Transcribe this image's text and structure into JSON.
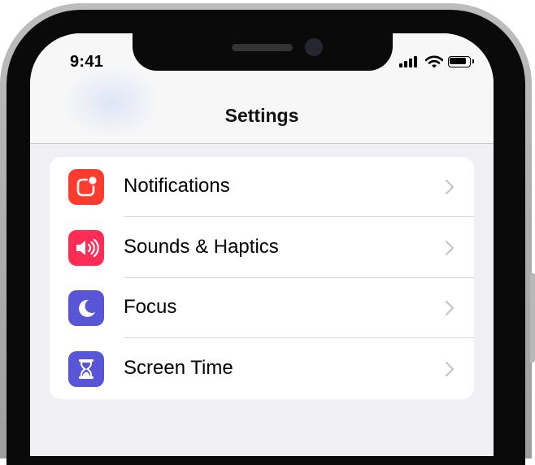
{
  "status_bar": {
    "time": "9:41",
    "signal_icon": "cellular-signal-icon",
    "wifi_icon": "wifi-icon",
    "battery_icon": "battery-icon",
    "battery_level": 0.9
  },
  "header": {
    "title": "Settings"
  },
  "settings": {
    "items": [
      {
        "label": "Notifications",
        "icon": "notifications-icon",
        "color": "#ff3b30"
      },
      {
        "label": "Sounds & Haptics",
        "icon": "speaker-icon",
        "color": "#ff2d55"
      },
      {
        "label": "Focus",
        "icon": "moon-icon",
        "color": "#5856d6"
      },
      {
        "label": "Screen Time",
        "icon": "hourglass-icon",
        "color": "#5856d6"
      }
    ]
  }
}
